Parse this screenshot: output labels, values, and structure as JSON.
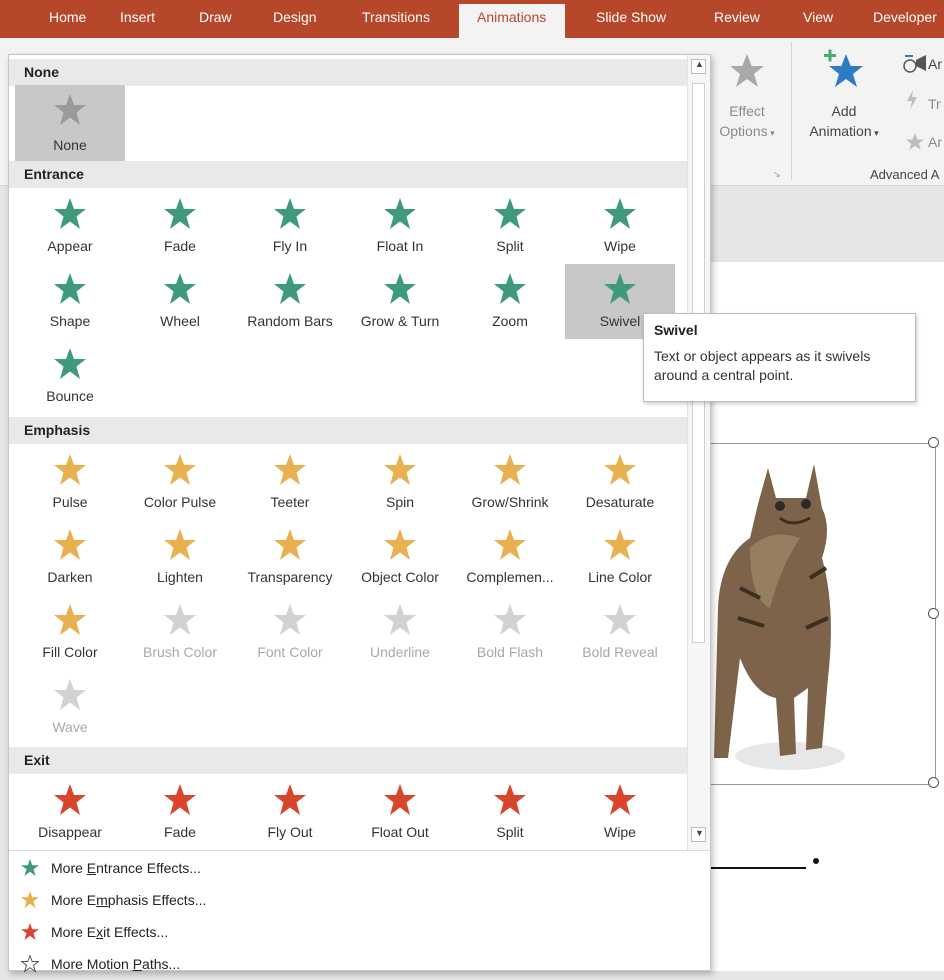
{
  "ribbon_tabs": {
    "home": "Home",
    "insert": "Insert",
    "draw": "Draw",
    "design": "Design",
    "transitions": "Transitions",
    "animations": "Animations",
    "slideshow": "Slide Show",
    "review": "Review",
    "view": "View",
    "developer": "Developer"
  },
  "ribbon": {
    "effect_options_line1": "Effect",
    "effect_options_line2": "Options",
    "add_animation_line1": "Add",
    "add_animation_line2": "Animation",
    "adv_item1": "Ar",
    "adv_item2": "Tr",
    "adv_item3": "Ar",
    "advanced_group_label": "Advanced A"
  },
  "gallery": {
    "none_section": "None",
    "none_label": "None",
    "entrance_section": "Entrance",
    "entrance_effects": [
      "Appear",
      "Fade",
      "Fly In",
      "Float In",
      "Split",
      "Wipe",
      "Shape",
      "Wheel",
      "Random Bars",
      "Grow & Turn",
      "Zoom",
      "Swivel",
      "Bounce"
    ],
    "emphasis_section": "Emphasis",
    "emphasis_effects": [
      "Pulse",
      "Color Pulse",
      "Teeter",
      "Spin",
      "Grow/Shrink",
      "Desaturate",
      "Darken",
      "Lighten",
      "Transparency",
      "Object Color",
      "Complemen...",
      "Line Color",
      "Fill Color",
      "Brush Color",
      "Font Color",
      "Underline",
      "Bold Flash",
      "Bold Reveal",
      "Wave"
    ],
    "exit_section": "Exit",
    "exit_effects": [
      "Disappear",
      "Fade",
      "Fly Out",
      "Float Out",
      "Split",
      "Wipe"
    ],
    "more_entrance": {
      "pre": "More ",
      "key": "E",
      "post": "ntrance Effects..."
    },
    "more_emphasis": {
      "pre": "More E",
      "key": "m",
      "post": "phasis Effects..."
    },
    "more_exit": {
      "pre": "More E",
      "key": "x",
      "post": "it Effects..."
    },
    "more_motion": {
      "pre": "More Motion ",
      "key": "P",
      "post": "aths..."
    }
  },
  "tooltip": {
    "title": "Swivel",
    "body_line1": "Text or object appears as it swivels",
    "body_line2": "around a central point."
  },
  "colors": {
    "accent": "#b7472a",
    "entrance": "#3f9a7a",
    "emphasis": "#e8b04f",
    "exit": "#d9452c",
    "disabled": "#a8a8a8"
  }
}
